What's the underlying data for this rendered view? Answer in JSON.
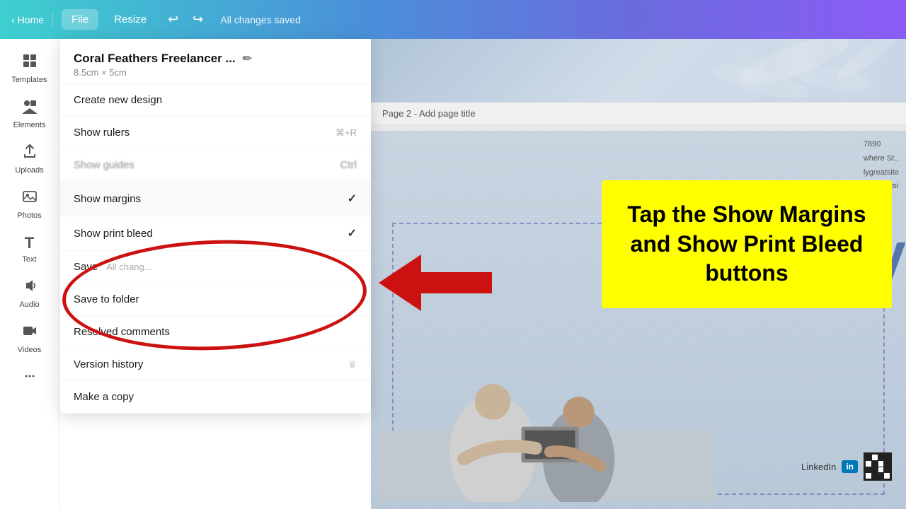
{
  "topbar": {
    "home_label": "Home",
    "file_label": "File",
    "resize_label": "Resize",
    "undo_symbol": "↩",
    "redo_symbol": "↪",
    "status": "All changes saved"
  },
  "sidebar": {
    "items": [
      {
        "id": "templates",
        "icon": "⊞",
        "label": "Templates"
      },
      {
        "id": "elements",
        "icon": "✦",
        "label": "Elements"
      },
      {
        "id": "uploads",
        "icon": "☁",
        "label": "Uploads"
      },
      {
        "id": "photos",
        "icon": "🖼",
        "label": "Photos"
      },
      {
        "id": "text",
        "icon": "T",
        "label": "Text"
      },
      {
        "id": "audio",
        "icon": "♫",
        "label": "Audio"
      },
      {
        "id": "videos",
        "icon": "▶",
        "label": "Videos"
      },
      {
        "id": "more",
        "icon": "⋯",
        "label": ""
      }
    ]
  },
  "file_menu": {
    "title": "Coral Feathers Freelancer ...",
    "subtitle": "8.5cm × 5cm",
    "pencil_icon": "✏",
    "items": [
      {
        "id": "create-new",
        "label": "Create new design",
        "shortcut": "",
        "checked": false
      },
      {
        "id": "show-rulers",
        "label": "Show rulers",
        "shortcut": "⌘+R",
        "checked": false,
        "blurred": false
      },
      {
        "id": "show-guides",
        "label": "Show guides",
        "shortcut": "Ctrl",
        "checked": false,
        "blurred": true
      },
      {
        "id": "show-margins",
        "label": "Show margins",
        "shortcut": "",
        "checked": true,
        "blurred": false
      },
      {
        "id": "show-print-bleed",
        "label": "Show print bleed",
        "shortcut": "",
        "checked": true,
        "blurred": false
      },
      {
        "id": "save",
        "label": "Save",
        "extra": "All chang...",
        "checked": false
      },
      {
        "id": "save-to-folder",
        "label": "Save to folder",
        "shortcut": "",
        "checked": false
      },
      {
        "id": "resolved-comments",
        "label": "Resolved comments",
        "shortcut": "",
        "checked": false
      },
      {
        "id": "version-history",
        "label": "Version history",
        "shortcut": "",
        "checked": false,
        "has_crown": true
      },
      {
        "id": "make-a-copy",
        "label": "Make a copy",
        "shortcut": "",
        "checked": false
      }
    ]
  },
  "canvas": {
    "page_title": "Page 2 - Add page title",
    "linkedin_text": "LinkedIn",
    "v_letter": "V"
  },
  "annotation": {
    "text": "Tap the Show Margins and Show Print Bleed buttons"
  }
}
